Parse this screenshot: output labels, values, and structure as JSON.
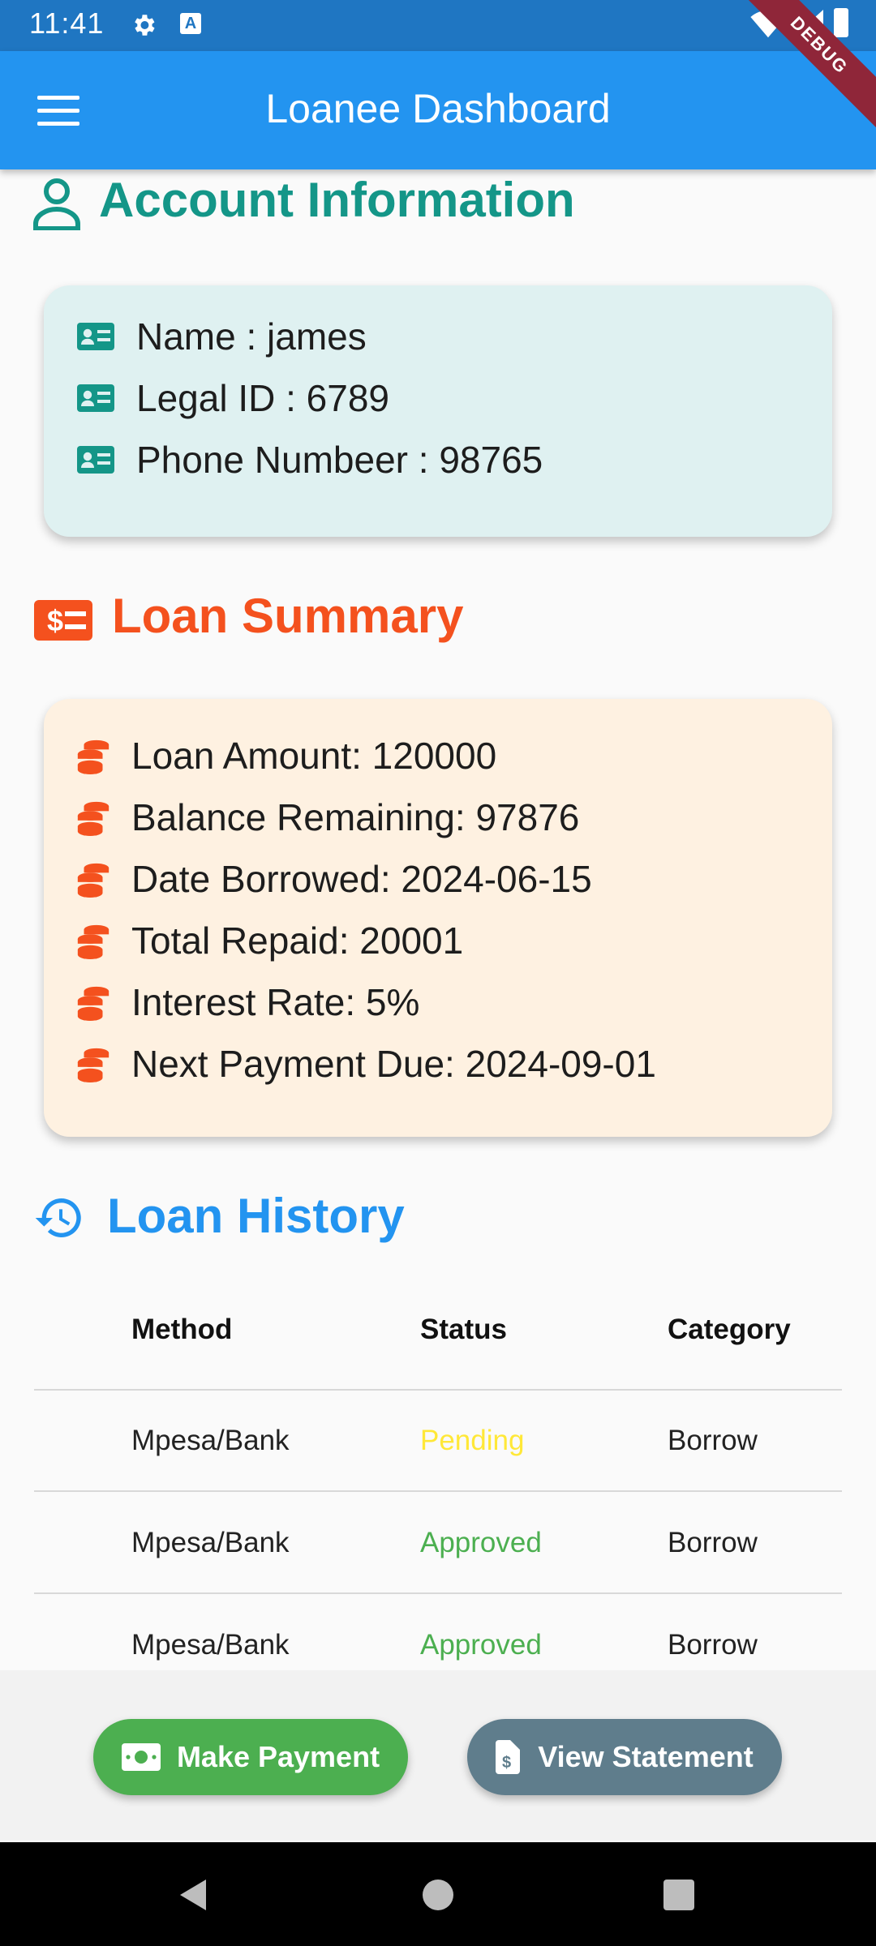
{
  "status_bar": {
    "time": "11:41"
  },
  "app_bar": {
    "title": "Loanee Dashboard",
    "debug_banner": "DEBUG"
  },
  "account": {
    "title": "Account Information",
    "rows": [
      {
        "label": "Name  :  james"
      },
      {
        "label": "Legal ID  :  6789"
      },
      {
        "label": "Phone Numbeer  :  98765"
      }
    ]
  },
  "summary": {
    "title": "Loan Summary",
    "rows": [
      {
        "label": "Loan Amount: 120000"
      },
      {
        "label": "Balance Remaining: 97876"
      },
      {
        "label": "Date Borrowed: 2024-06-15"
      },
      {
        "label": "Total Repaid: 20001"
      },
      {
        "label": "Interest Rate: 5%"
      },
      {
        "label": "Next Payment Due: 2024-09-01"
      }
    ]
  },
  "history": {
    "title": "Loan History",
    "columns": [
      "Method",
      "Status",
      "Category"
    ],
    "rows": [
      {
        "method": "Mpesa/Bank",
        "status": "Pending",
        "category": "Borrow"
      },
      {
        "method": "Mpesa/Bank",
        "status": "Approved",
        "category": "Borrow"
      },
      {
        "method": "Mpesa/Bank",
        "status": "Approved",
        "category": "Borrow"
      }
    ]
  },
  "actions": {
    "make_payment": "Make Payment",
    "view_statement": "View Statement"
  },
  "colors": {
    "app_bar": "#2394f0",
    "account_accent": "#149688",
    "account_card": "#dff1f1",
    "summary_accent": "#f4511e",
    "summary_card": "#fef1e1",
    "history_accent": "#2394f0",
    "status_pending": "#ffe838",
    "status_approved": "#4caf50",
    "make_payment_button": "#4caf50",
    "view_statement_button": "#5f7d8c"
  },
  "icons": {
    "account_title": "person-outline-icon",
    "account_rows": "id-card-icon",
    "summary_title": "money-bill-icon",
    "summary_rows": "coin-stack-icon",
    "history_title": "history-icon",
    "make_payment": "cash-icon",
    "view_statement": "invoice-icon"
  }
}
